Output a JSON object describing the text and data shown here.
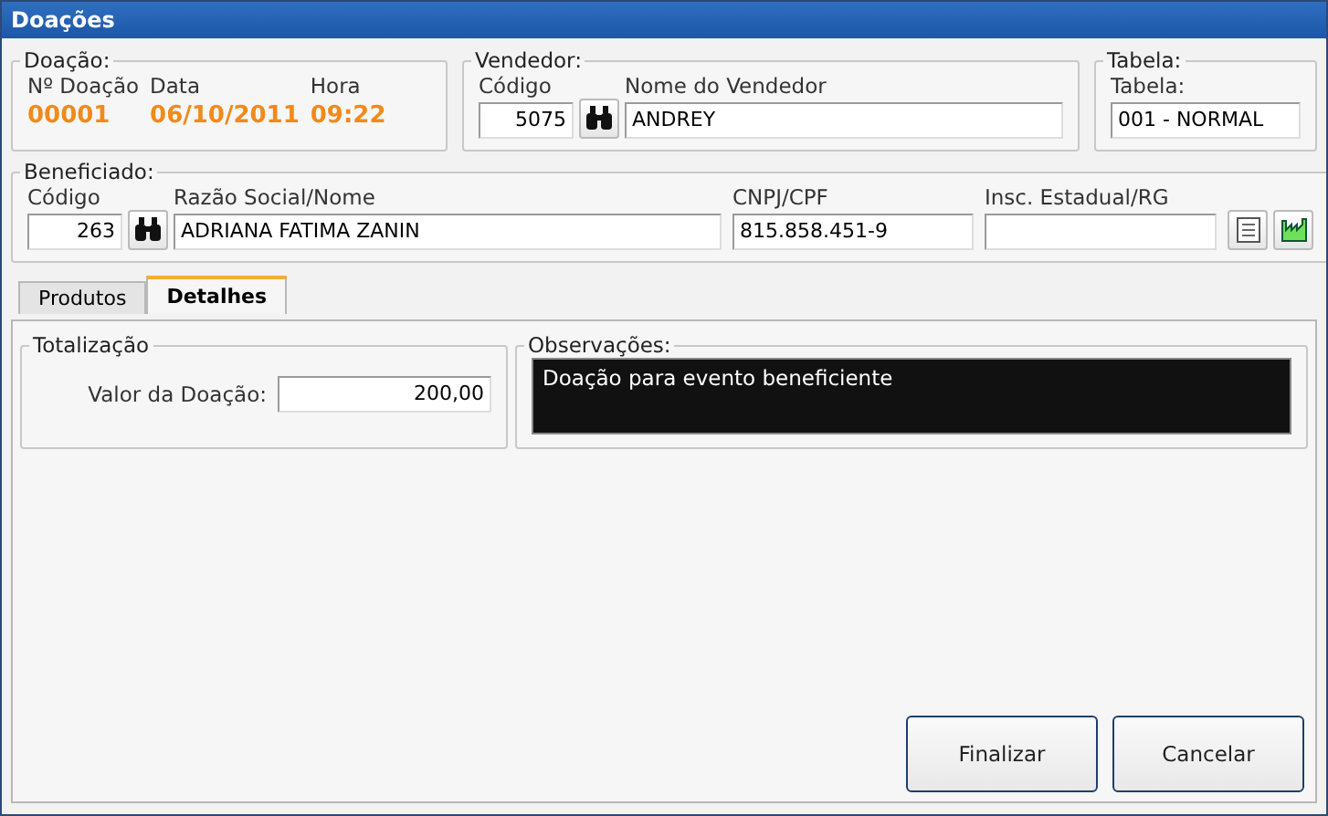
{
  "window": {
    "title": "Doações"
  },
  "doacao": {
    "legend": "Doação:",
    "number_label": "Nº Doação",
    "date_label": "Data",
    "time_label": "Hora",
    "number": "00001",
    "date": "06/10/2011",
    "time": "09:22"
  },
  "vendedor": {
    "legend": "Vendedor:",
    "code_label": "Código",
    "code": "5075",
    "name_label": "Nome do Vendedor",
    "name": "ANDREY"
  },
  "tabela": {
    "legend": "Tabela:",
    "label": "Tabela:",
    "value": "001 - NORMAL"
  },
  "beneficiado": {
    "legend": "Beneficiado:",
    "code_label": "Código",
    "code": "263",
    "name_label": "Razão Social/Nome",
    "name": "ADRIANA FATIMA ZANIN",
    "doc_label": "CNPJ/CPF",
    "doc": "815.858.451-9",
    "ie_label": "Insc. Estadual/RG"
  },
  "tabs": [
    {
      "label": "Produtos",
      "selected": false
    },
    {
      "label": "Detalhes",
      "selected": true
    }
  ],
  "totalizacao": {
    "legend": "Totalização",
    "label": "Valor da Doação:",
    "value": "200,00"
  },
  "observacoes": {
    "legend": "Observações:",
    "text": "Doação para evento beneficiente"
  },
  "buttons": [
    "Finalizar",
    "Cancelar"
  ]
}
